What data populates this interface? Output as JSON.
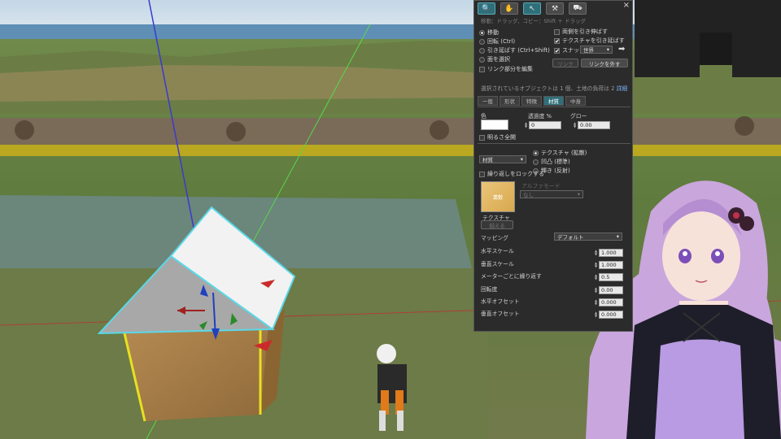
{
  "panel": {
    "hint": "移動：ドラッグ、コピー：Shift ＋ ドラッグ",
    "close": "×",
    "tools": [
      {
        "icon": "magnifier-icon",
        "glyph": "🔍"
      },
      {
        "icon": "hand-icon",
        "glyph": "✋"
      },
      {
        "icon": "cursor-icon",
        "glyph": "↖"
      },
      {
        "icon": "hammer-icon",
        "glyph": "⚒"
      },
      {
        "icon": "bulldozer-icon",
        "glyph": "⛟"
      }
    ],
    "modes": {
      "move": "移動",
      "rotate": "回転 (Ctrl)",
      "stretch": "引き延ばす (Ctrl+Shift)",
      "select_face": "面を選択",
      "edit_linked": "リンク部分を編集"
    },
    "options": {
      "stretch_both": "両側を引き伸ばす",
      "stretch_textures": "テクスチャを引き延ばす",
      "snap": "スナップ",
      "snap_value": "世界"
    },
    "link_button": "リンク",
    "unlink_button": "リンクを外す",
    "selection_info": "選択されているオブジェクトは 1 個、土地の負荷は 2",
    "selection_more": "詳細",
    "tabs": [
      "一般",
      "形状",
      "特徴",
      "材質",
      "中身"
    ],
    "color_label": "色",
    "transparency_label": "透過度 %",
    "transparency_value": "0",
    "glow_label": "グロー",
    "glow_value": "0.00",
    "full_bright": "明るさ全開",
    "material_select": "材質",
    "texture_radio": "テクスチャ (拡散)",
    "bump_radio": "凹凸 (標準)",
    "shiny_radio": "輝き (反射)",
    "lock_repeat": "繰り返しをロックする",
    "alpha_mode_label": "アルファモード",
    "alpha_mode_value": "なし",
    "texture_label": "テクスチャ",
    "texture_thumb": "藁敷",
    "align_button": "揃える",
    "mapping_label": "マッピング",
    "mapping_value": "デフォルト",
    "fields": [
      {
        "label": "水平スケール",
        "value": "1.000"
      },
      {
        "label": "垂直スケール",
        "value": "1.000"
      },
      {
        "label": "メーターごとに繰り返す",
        "value": "0.5"
      },
      {
        "label": "回転度",
        "value": "0.00"
      },
      {
        "label": "水平オフセット",
        "value": "0.000"
      },
      {
        "label": "垂直オフセット",
        "value": "0.000"
      }
    ]
  }
}
